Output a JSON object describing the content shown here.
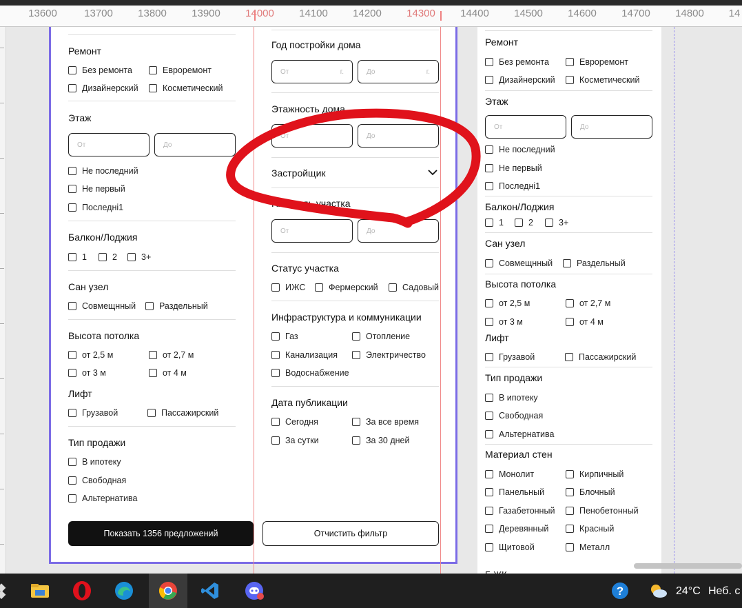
{
  "ruler": {
    "ticks": [
      "13600",
      "13700",
      "13800",
      "13900",
      "14000",
      "14100",
      "14200",
      "14300",
      "14400",
      "14500",
      "14600",
      "14700",
      "14800",
      "14"
    ]
  },
  "left_col": {
    "remont": {
      "title": "Ремонт",
      "opts": [
        "Без ремонта",
        "Евроремонт",
        "Дизайнерский",
        "Косметический"
      ]
    },
    "floor": {
      "title": "Этаж",
      "from": "От",
      "to": "До",
      "opts": [
        "Не последний",
        "Не первый",
        "Последні1"
      ]
    },
    "balcony": {
      "title": "Балкон/Лоджия",
      "opts": [
        "1",
        "2",
        "3+"
      ]
    },
    "bath": {
      "title": "Сан узел",
      "opts": [
        "Совмещнный",
        "Раздельный"
      ]
    },
    "ceiling": {
      "title": "Высота потолка",
      "opts": [
        "от 2,5 м",
        "от 2,7 м",
        "от 3 м",
        "от 4 м"
      ]
    },
    "lift": {
      "title": "Лифт",
      "opts": [
        "Грузавой",
        "Пассажирский"
      ]
    },
    "sale": {
      "title": "Тип продажи",
      "opts": [
        "В ипотеку",
        "Свободная",
        "Альтернатива"
      ]
    },
    "show_btn": "Показать 1356 предложений"
  },
  "mid_col": {
    "year": {
      "title": "Год постройки дома",
      "from": "От",
      "from_unit": "г.",
      "to": "До",
      "to_unit": "г."
    },
    "floors": {
      "title": "Этажность дома",
      "from": "От",
      "to": "До"
    },
    "builder": {
      "title": "Застройщик"
    },
    "area": {
      "title": "Площадь участка",
      "from": "От",
      "to": "До"
    },
    "status": {
      "title": "Статус участка",
      "opts": [
        "ИЖС",
        "Фермерский",
        "Садовый"
      ]
    },
    "infra": {
      "title": "Инфраструктура и коммуникации",
      "opts": [
        "Газ",
        "Отопление",
        "Канализация",
        "Электричество",
        "Водоснабжение"
      ]
    },
    "pub": {
      "title": "Дата публикации",
      "opts": [
        "Сегодня",
        "За все время",
        "За сутки",
        "За 30 дней"
      ]
    },
    "clear_btn": "Отчистить фильтр"
  },
  "right_col": {
    "remont": {
      "title": "Ремонт",
      "opts": [
        "Без ремонта",
        "Евроремонт",
        "Дизайнерский",
        "Косметический"
      ]
    },
    "floor": {
      "title": "Этаж",
      "from": "От",
      "to": "До",
      "opts": [
        "Не последний",
        "Не первый",
        "Последні1"
      ]
    },
    "balcony": {
      "title": "Балкон/Лоджия",
      "opts": [
        "1",
        "2",
        "3+"
      ]
    },
    "bath": {
      "title": "Сан узел",
      "opts": [
        "Совмещнный",
        "Раздельный"
      ]
    },
    "ceiling": {
      "title": "Высота потолка",
      "opts": [
        "от 2,5 м",
        "от 2,7 м",
        "от 3 м",
        "от 4 м"
      ]
    },
    "lift": {
      "title": "Лифт",
      "opts": [
        "Грузавой",
        "Пассажирский"
      ]
    },
    "sale": {
      "title": "Тип продажи",
      "opts": [
        "В ипотеку",
        "Свободная",
        "Альтернатива"
      ]
    },
    "walls": {
      "title": "Материал стен",
      "opts": [
        "Монолит",
        "Кирпичный",
        "Панельный",
        "Блочный",
        "Газабетонный",
        "Пенобетонный",
        "Деревянный",
        "Красный",
        "Щитовой",
        "Металл"
      ]
    },
    "cut_label": "Б ЖК"
  },
  "taskbar": {
    "icons": [
      "files-icon",
      "file-explorer-icon",
      "opera-icon",
      "edge-icon",
      "chrome-icon",
      "vscode-icon",
      "discord-icon"
    ],
    "temp": "24°C",
    "weather": "Неб. с"
  },
  "colors": {
    "frame": "#7b6be6",
    "guide": "#f08a8a",
    "annotation": "#e0121b"
  }
}
